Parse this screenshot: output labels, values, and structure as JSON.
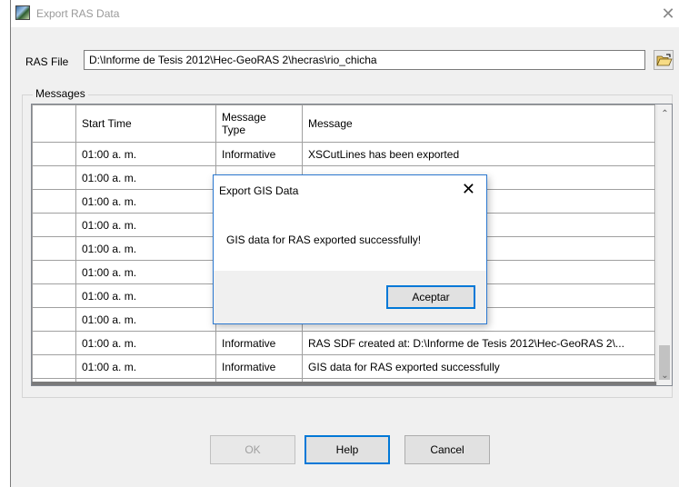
{
  "window": {
    "title": "Export RAS Data",
    "close_glyph": "✕",
    "icon": "app-map-icon"
  },
  "ras_file": {
    "label": "RAS File",
    "value": "D:\\Informe de Tesis 2012\\Hec-GeoRAS 2\\hecras\\rio_chicha",
    "browse_icon": "folder-open-icon"
  },
  "messages": {
    "group_label": "Messages",
    "columns": [
      "Start Time",
      "Message\nType",
      "Message"
    ],
    "rows": [
      {
        "time": "01:00 a. m.",
        "type": "Informative",
        "message": "XSCutLines has been exported"
      },
      {
        "time": "01:00 a. m.",
        "type": "",
        "message": ""
      },
      {
        "time": "01:00 a. m.",
        "type": "",
        "message": ""
      },
      {
        "time": "01:00 a. m.",
        "type": "",
        "message": ""
      },
      {
        "time": "01:00 a. m.",
        "type": "",
        "message": ""
      },
      {
        "time": "01:00 a. m.",
        "type": "",
        "message": "fully exported."
      },
      {
        "time": "01:00 a. m.",
        "type": "",
        "message": "me de Tesis 2012\\Hec-GeoR..."
      },
      {
        "time": "01:00 a. m.",
        "type": "",
        "message": "Tesis 2012\\Hec-GeoRAS 2\\h..."
      },
      {
        "time": "01:00 a. m.",
        "type": "Informative",
        "message": "RAS SDF created at: D:\\Informe de Tesis 2012\\Hec-GeoRAS 2\\..."
      },
      {
        "time": "01:00 a. m.",
        "type": "Informative",
        "message": "GIS data for RAS exported successfully"
      }
    ],
    "new_row_marker": "✱"
  },
  "buttons": {
    "ok": "OK",
    "help": "Help",
    "cancel": "Cancel"
  },
  "dialog": {
    "title": "Export GIS Data",
    "close_glyph": "✕",
    "message": "GIS data for RAS exported successfully!",
    "ok": "Aceptar"
  }
}
